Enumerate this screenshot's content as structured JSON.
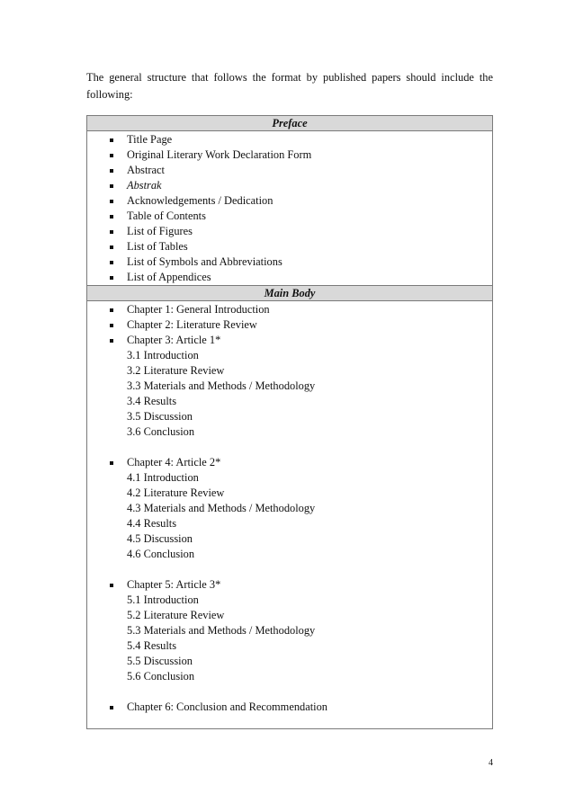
{
  "intro_text": "The general structure that follows the format by published papers should include the following:",
  "preface": {
    "title": "Preface",
    "items": [
      {
        "label": "Title Page",
        "italic": false
      },
      {
        "label": "Original Literary Work Declaration Form",
        "italic": false
      },
      {
        "label": "Abstract",
        "italic": false
      },
      {
        "label": "Abstrak",
        "italic": true
      },
      {
        "label": "Acknowledgements / Dedication",
        "italic": false
      },
      {
        "label": "Table of Contents",
        "italic": false
      },
      {
        "label": "List of Figures",
        "italic": false
      },
      {
        "label": "List of Tables",
        "italic": false
      },
      {
        "label": "List of Symbols and Abbreviations",
        "italic": false
      },
      {
        "label": "List of Appendices",
        "italic": false
      }
    ]
  },
  "main_body": {
    "title": "Main Body",
    "chapters": [
      {
        "label": "Chapter 1: General Introduction",
        "subsections": []
      },
      {
        "label": "Chapter 2: Literature Review",
        "subsections": []
      },
      {
        "label": "Chapter 3: Article 1*",
        "subsections": [
          "3.1 Introduction",
          "3.2 Literature Review",
          "3.3 Materials and Methods / Methodology",
          "3.4 Results",
          "3.5 Discussion",
          "3.6 Conclusion"
        ]
      },
      {
        "label": "Chapter 4: Article 2*",
        "subsections": [
          "4.1 Introduction",
          "4.2 Literature Review",
          "4.3 Materials and Methods / Methodology",
          "4.4 Results",
          "4.5 Discussion",
          "4.6 Conclusion"
        ]
      },
      {
        "label": "Chapter 5: Article 3*",
        "subsections": [
          "5.1 Introduction",
          "5.2 Literature Review",
          "5.3 Materials and Methods / Methodology",
          "5.4 Results",
          "5.5 Discussion",
          "5.6 Conclusion"
        ]
      },
      {
        "label": "Chapter 6: Conclusion and Recommendation",
        "subsections": []
      }
    ]
  },
  "page_number": "4",
  "colors": {
    "header_background": "#d9d9d9",
    "border": "#7a7a7a",
    "text": "#111111"
  }
}
